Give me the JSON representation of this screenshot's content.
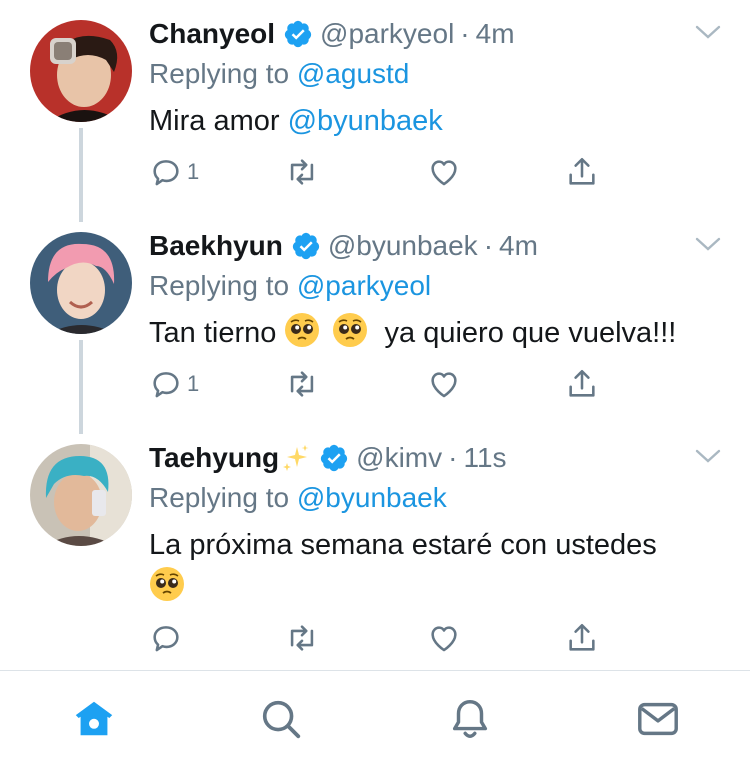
{
  "tweets": [
    {
      "display_name": "Chanyeol",
      "handle": "@parkyeol",
      "time": "4m",
      "replying_prefix": "Replying to",
      "replying_to": "@agustd",
      "text": "Mira amor",
      "mention": "@byunbaek",
      "reply_count": "1"
    },
    {
      "display_name": "Baekhyun",
      "handle": "@byunbaek",
      "time": "4m",
      "replying_prefix": "Replying to",
      "replying_to": "@parkyeol",
      "text_before": "Tan tierno",
      "text_after": "ya quiero que vuelva!!!",
      "reply_count": "1"
    },
    {
      "display_name": "Taehyung",
      "handle": "@kimv",
      "time": "11s",
      "replying_prefix": "Replying to",
      "replying_to": "@byunbaek",
      "text": "La próxima semana estaré con ustedes",
      "reply_count": ""
    }
  ],
  "separator": "·",
  "colors": {
    "accent": "#1da1f2",
    "mention": "#1b95e0",
    "secondary_text": "#657786",
    "thread_line": "#cdd6dd"
  },
  "tabbar": {
    "items": [
      "home-icon",
      "search-icon",
      "notifications-icon",
      "messages-icon"
    ],
    "active": "home-icon"
  }
}
